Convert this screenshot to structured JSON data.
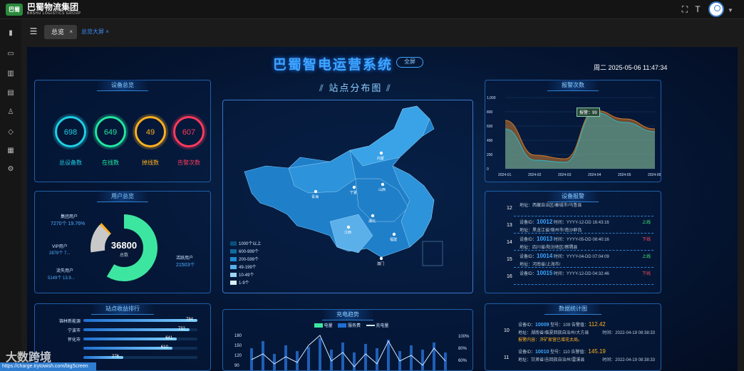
{
  "app": {
    "brand": "巴蜀物流集团",
    "brand_sub": "BASHU LOGISTICS GROUP",
    "logo_mark": "巴蜀"
  },
  "tabs": [
    {
      "label": "总览"
    },
    {
      "label": "总览大屏"
    }
  ],
  "screen": {
    "title": "巴蜀智电运营系统",
    "fullscreen_label": "全屏",
    "datetime": "周二 2025-05-06 11:47:34"
  },
  "device_overview": {
    "title": "设备总览",
    "rings": [
      {
        "value": "698",
        "label": "总设备数",
        "color": "#1ed0e6"
      },
      {
        "value": "649",
        "label": "在线数",
        "color": "#22e6a0"
      },
      {
        "value": "49",
        "label": "掉线数",
        "color": "#ffb020"
      },
      {
        "value": "607",
        "label": "告警次数",
        "color": "#ff3a5c"
      }
    ]
  },
  "user_overview": {
    "title": "用户总览",
    "total": "36800",
    "total_label": "总数",
    "segments": [
      {
        "name": "集团用户",
        "detail": "7270个  19.76%",
        "color": "#ff3a6a",
        "value": 19.76
      },
      {
        "name": "VIP用户",
        "detail": "2878个  7...",
        "color": "#ffb020",
        "value": 7.8
      },
      {
        "name": "流失用户",
        "detail": "5149个  13.9...",
        "color": "#c9c9c9",
        "value": 13.99
      },
      {
        "name": "活跃用户",
        "detail": "21503个",
        "color": "#3de6a0",
        "value": 58.45
      }
    ]
  },
  "station_ranking": {
    "title": "站点收益排行",
    "items": [
      {
        "name": "锦林新能源",
        "value": "784",
        "pct": 1.0
      },
      {
        "name": "宁波市",
        "value": "732",
        "pct": 0.93
      },
      {
        "name": "怀化市",
        "value": "641",
        "pct": 0.82
      },
      {
        "name": "",
        "value": "610",
        "pct": 0.78
      },
      {
        "name": "",
        "value": "276",
        "pct": 0.35
      }
    ]
  },
  "map": {
    "title": "站点分布图",
    "legend": [
      {
        "label": "1000个以上",
        "color": "#0a4f7a"
      },
      {
        "label": "600-999个",
        "color": "#0f6aa0"
      },
      {
        "label": "200-599个",
        "color": "#1f8ad0"
      },
      {
        "label": "49-199个",
        "color": "#5bb0ea"
      },
      {
        "label": "10-49个",
        "color": "#9fd4f5"
      },
      {
        "label": "1-9个",
        "color": "#d8eefc"
      }
    ],
    "markers": [
      "内蒙",
      "青海",
      "宁夏",
      "山西",
      "湖北",
      "江西",
      "福建",
      "澳门"
    ]
  },
  "alarm_count": {
    "title": "报警次数",
    "tooltip": "报警：99",
    "chart_data": {
      "type": "area",
      "x": [
        "2024-01",
        "2024-02",
        "2024-03",
        "2024-04",
        "2024-05",
        "2024-06"
      ],
      "ylim": [
        0,
        1000
      ],
      "yticks": [
        "0",
        "200",
        "400",
        "600",
        "800",
        "1,000"
      ],
      "series": [
        {
          "values": [
            680,
            190,
            140,
            820,
            700,
            560
          ],
          "color": "#d07a2a"
        },
        {
          "values": [
            560,
            120,
            90,
            790,
            650,
            520
          ],
          "color": "#2fb7c8"
        }
      ]
    }
  },
  "device_report": {
    "title": "设备报警",
    "rows": [
      {
        "idx": "12",
        "addr": "地址：西藏自治区/秦城市/乌鲁县",
        "id": "",
        "time": "",
        "status": ""
      },
      {
        "idx": "13",
        "id_label": "设备ID：",
        "id": "10012",
        "time": "时间：YYYY-12-DD 16:43:16",
        "status": "上线",
        "addr": "地址：黑龙江省/宿州市/南沙群岛"
      },
      {
        "idx": "14",
        "id_label": "设备ID：",
        "id": "10013",
        "time": "时间：YYYY-05-DD 08:40:16",
        "status": "下线",
        "addr": "地址：四川省/阳汾地区/察隅县"
      },
      {
        "idx": "15",
        "id_label": "设备ID：",
        "id": "10014",
        "time": "时间：YYYY-04-DD 07:04:09",
        "status": "上线",
        "addr": "地址：河南省/上海市/"
      },
      {
        "idx": "16",
        "id_label": "设备ID：",
        "id": "10015",
        "time": "时间：YYYY-12-DD 04:32:46",
        "status": "下线",
        "addr": ""
      }
    ]
  },
  "charge_trend": {
    "title": "充电趋势",
    "legend": [
      "电量",
      "服务费",
      "充电量"
    ],
    "yticks_left": [
      "180",
      "150",
      "120",
      "90"
    ],
    "yticks_right": [
      "100%",
      "80%",
      "60%"
    ]
  },
  "data_stats": {
    "title": "数据统计图",
    "rows": [
      {
        "idx": "10",
        "id_label": "设备ID：",
        "id": "10009",
        "no": "型号：109",
        "temp_label": "告警值：",
        "temp": "112.42",
        "addr": "地址：湖南省/临夏回族自治州/大方县",
        "time": "时间：2022-04-19 08:38:33",
        "msg": "报警内容：济矿家营已增花太局。"
      },
      {
        "idx": "11",
        "id_label": "设备ID：",
        "id": "10010",
        "no": "型号：110",
        "temp_label": "告警值：",
        "temp": "145.19",
        "addr": "地址：甘肃省/吉回族自治州/雷溪县",
        "time": "时间：2022-04-19 08:38:33",
        "msg": ""
      }
    ]
  },
  "footer": {
    "url": "https://charge.trytowish.com/bigScreen"
  },
  "watermark": "大数跨境"
}
